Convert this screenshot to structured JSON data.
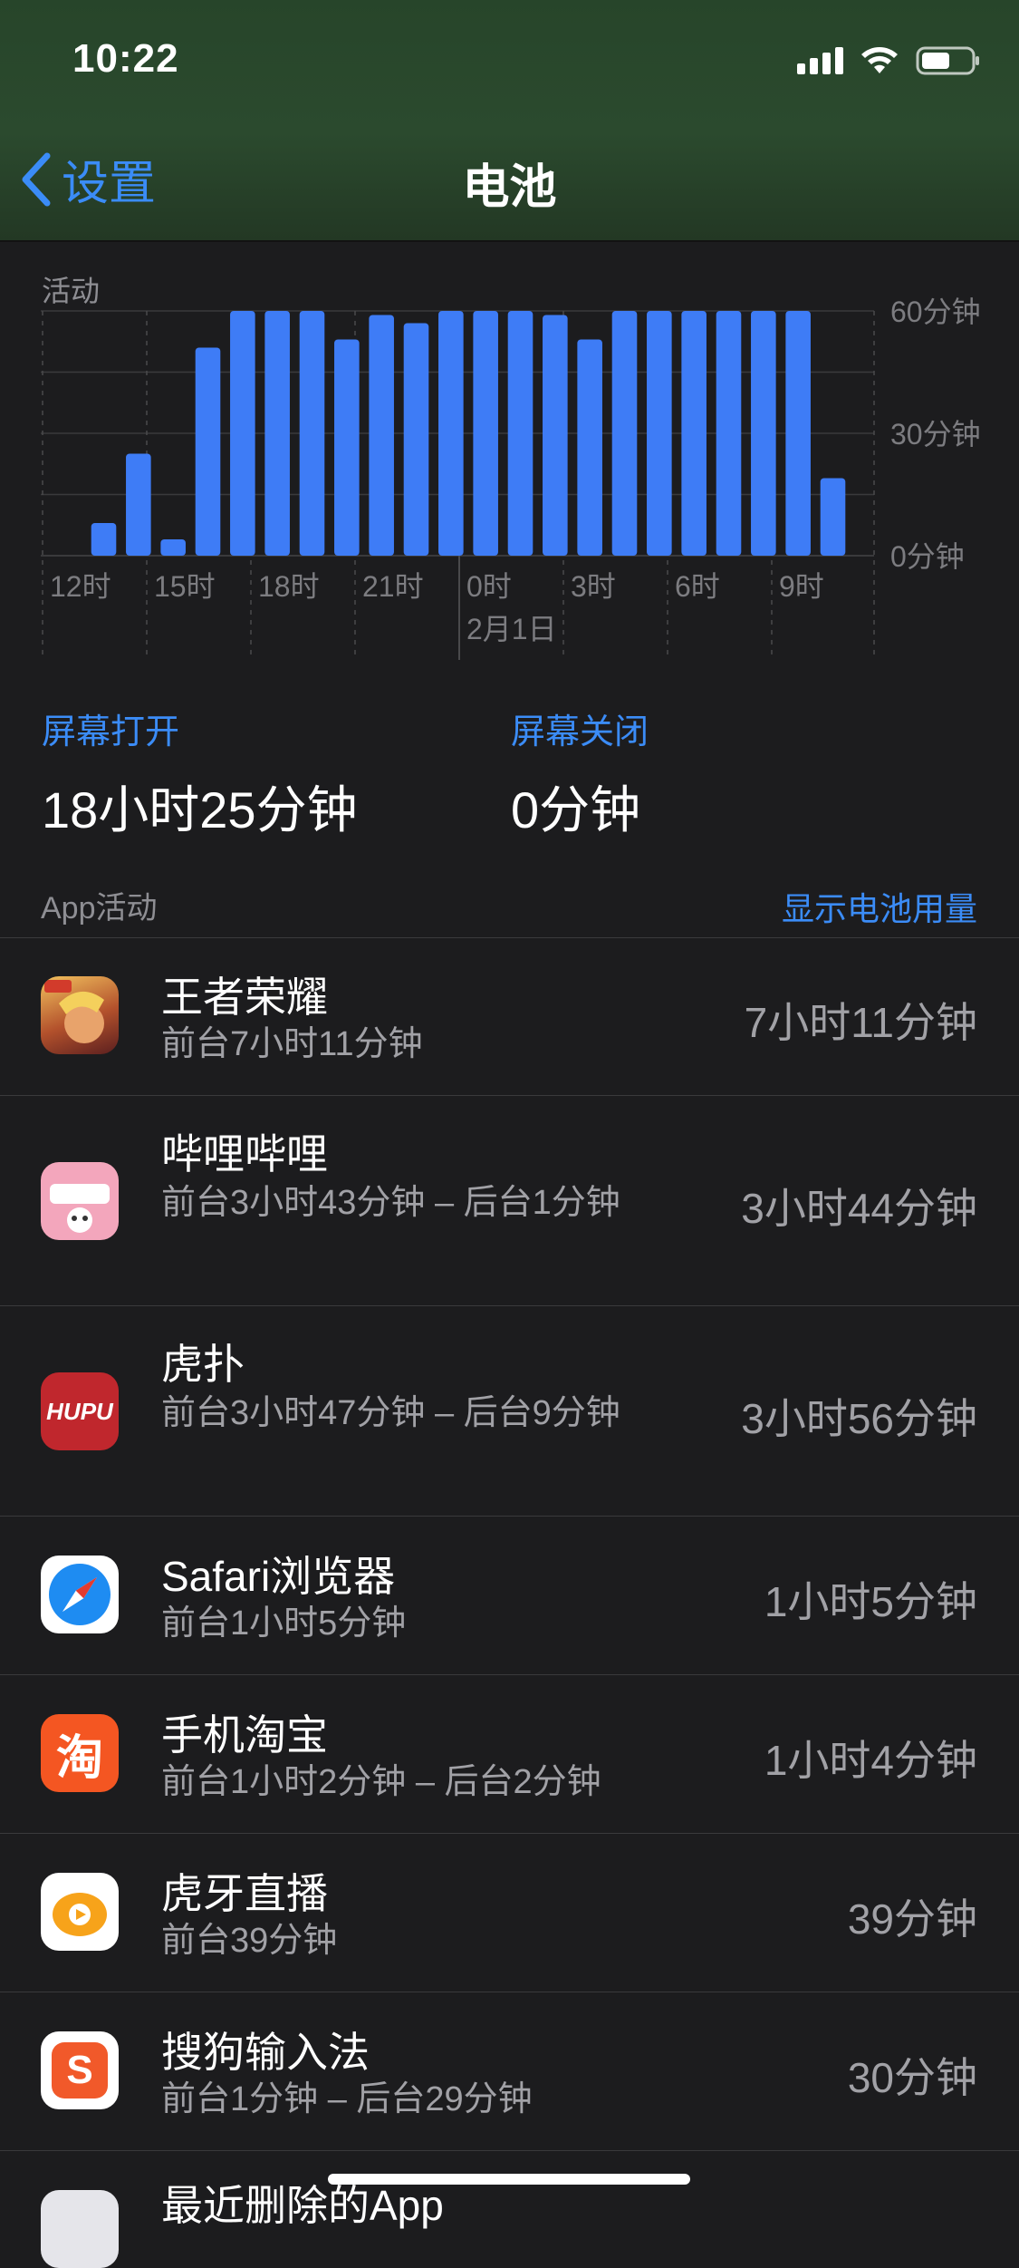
{
  "status_bar": {
    "time": "10:22"
  },
  "nav": {
    "back_label": "设置",
    "title": "电池"
  },
  "activity": {
    "label": "活动",
    "screen_on": {
      "title": "屏幕打开",
      "value": "18小时25分钟"
    },
    "screen_off": {
      "title": "屏幕关闭",
      "value": "0分钟"
    }
  },
  "chart_data": {
    "type": "bar",
    "title": "活动",
    "y_tick_labels": [
      "60分钟",
      "30分钟",
      "0分钟"
    ],
    "ylim": [
      0,
      60
    ],
    "x_tick_labels": [
      "12时",
      "15时",
      "18时",
      "21时",
      "0时",
      "3时",
      "6时",
      "9时"
    ],
    "date_label": "2月1日",
    "values": [
      0,
      8,
      25,
      4,
      51,
      60,
      60,
      60,
      53,
      59,
      57,
      60,
      60,
      60,
      59,
      53,
      60,
      60,
      60,
      60,
      60,
      60,
      19
    ],
    "color": "#3e7cf6",
    "grid": true
  },
  "app_activity": {
    "label": "App活动",
    "action": "显示电池用量",
    "apps": [
      {
        "name": "王者荣耀",
        "detail": "前台7小时11分钟",
        "time": "7小时11分钟",
        "icon": "honor-of-kings-icon"
      },
      {
        "name": "哔哩哔哩",
        "detail": "前台3小时43分钟 – 后台1分钟",
        "time": "3小时44分钟",
        "icon": "bilibili-icon"
      },
      {
        "name": "虎扑",
        "detail": "前台3小时47分钟 – 后台9分钟",
        "time": "3小时56分钟",
        "icon": "hupu-icon",
        "icon_text": "HUPU"
      },
      {
        "name": "Safari浏览器",
        "detail": "前台1小时5分钟",
        "time": "1小时5分钟",
        "icon": "safari-icon"
      },
      {
        "name": "手机淘宝",
        "detail": "前台1小时2分钟 – 后台2分钟",
        "time": "1小时4分钟",
        "icon": "taobao-icon",
        "icon_text": "淘"
      },
      {
        "name": "虎牙直播",
        "detail": "前台39分钟",
        "time": "39分钟",
        "icon": "huya-icon"
      },
      {
        "name": "搜狗输入法",
        "detail": "前台1分钟 – 后台29分钟",
        "time": "30分钟",
        "icon": "sogou-icon",
        "icon_text": "S"
      },
      {
        "name": "最近删除的App",
        "detail": "",
        "time": "",
        "icon": "deleted-apps-icon"
      }
    ]
  }
}
